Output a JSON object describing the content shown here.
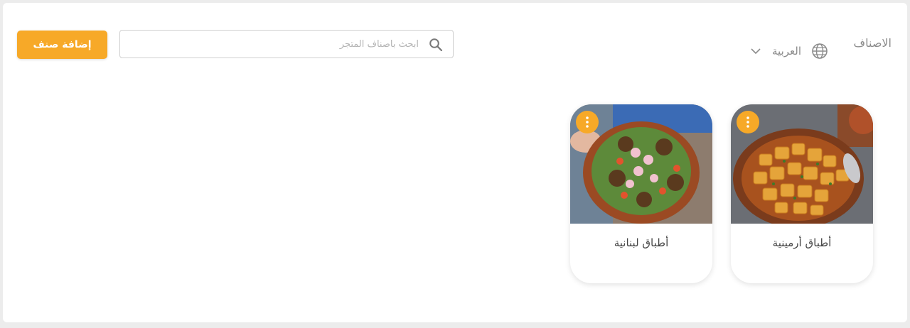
{
  "header": {
    "title": "الاصناف",
    "language": {
      "label": "العربية",
      "icon": "globe-icon",
      "dropdown_icon": "chevron-down-icon"
    },
    "search": {
      "placeholder": "ابحث باصناف المتجر",
      "value": "",
      "icon": "search-icon"
    },
    "add_button_label": "إضافة صنف"
  },
  "categories": [
    {
      "name": "أطباق أرمينية",
      "image": "roasted-potatoes-dish-image",
      "menu_icon": "more-vertical-icon"
    },
    {
      "name": "أطباق لبنانية",
      "image": "falafel-salad-bowl-image",
      "menu_icon": "more-vertical-icon"
    }
  ],
  "colors": {
    "accent": "#f7a928",
    "text_muted": "#8c8c8c",
    "card_text": "#444444"
  }
}
